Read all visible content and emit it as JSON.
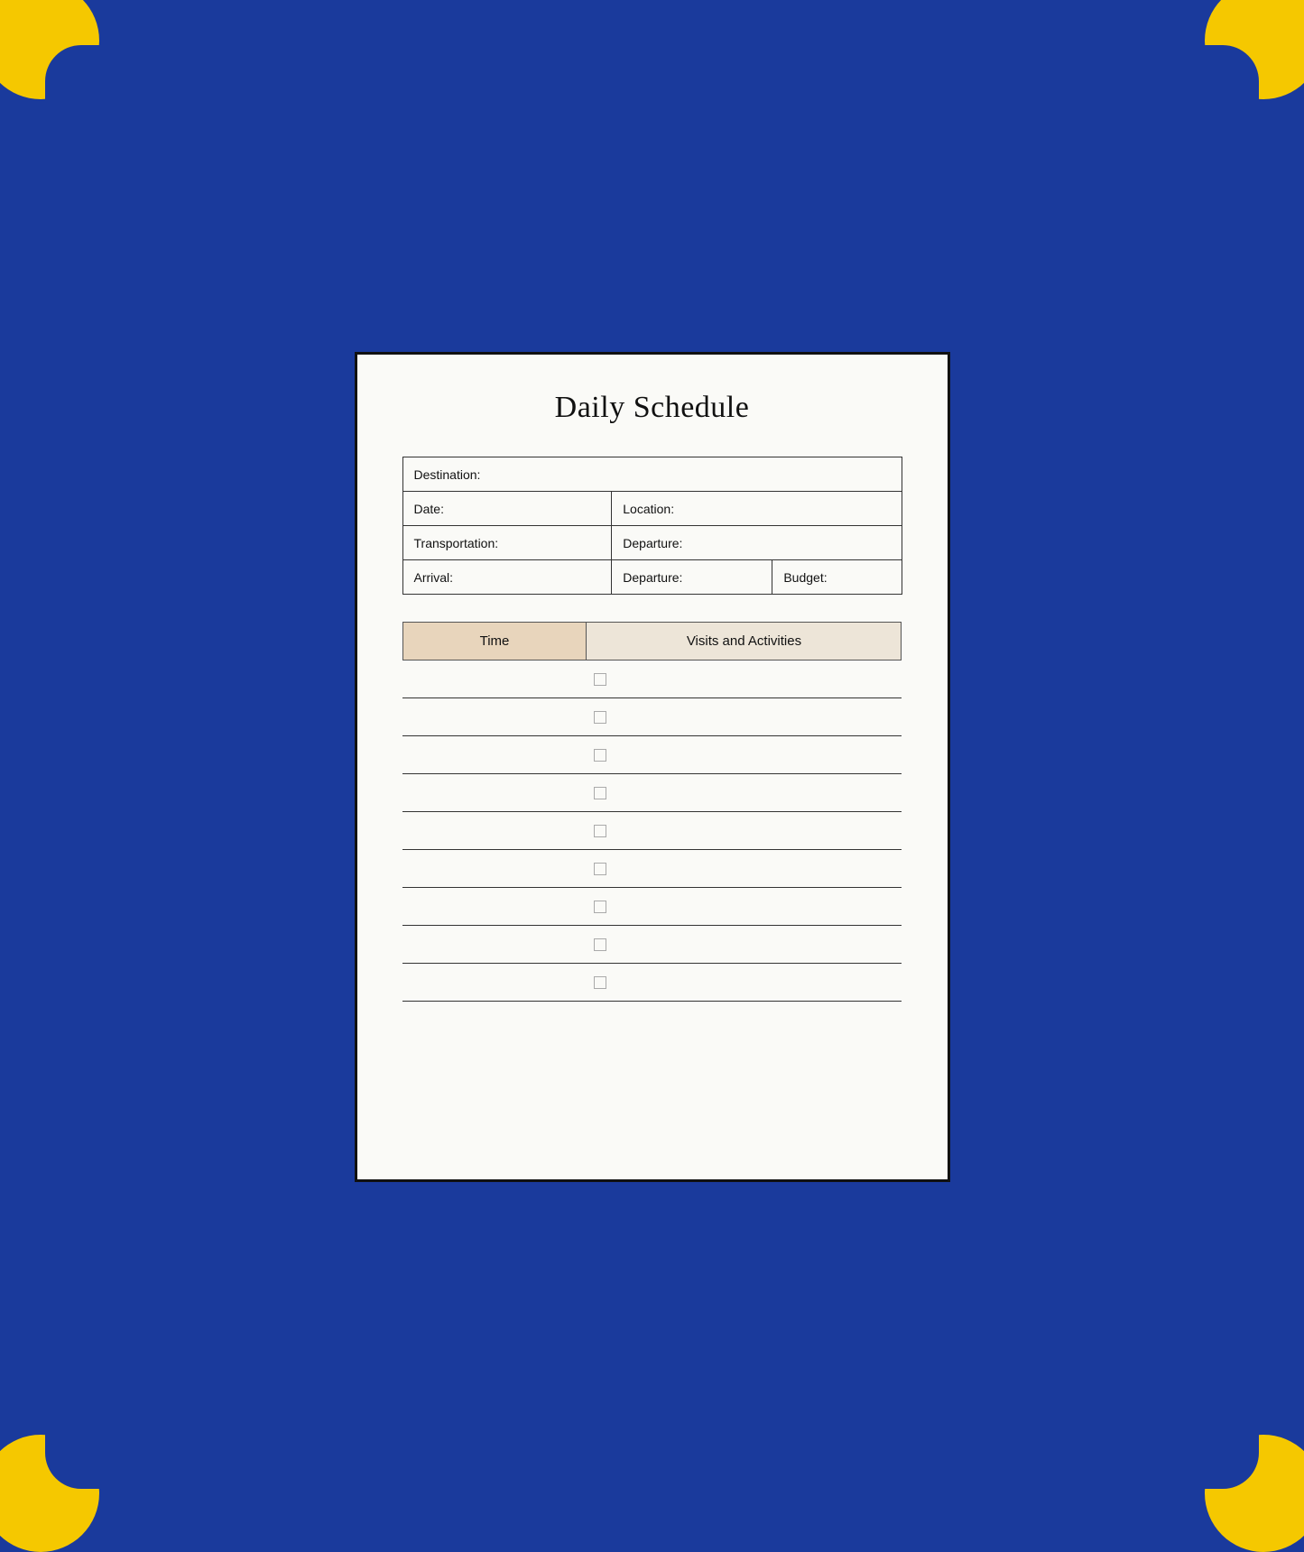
{
  "page": {
    "title": "Daily Schedule",
    "background_color": "#1a3a9c",
    "corner_color": "#f5c800"
  },
  "info_fields": {
    "destination_label": "Destination:",
    "date_label": "Date:",
    "location_label": "Location:",
    "transportation_label": "Transportation:",
    "departure_label": "Departure:",
    "arrival_label": "Arrival:",
    "departure2_label": "Departure:",
    "budget_label": "Budget:"
  },
  "schedule": {
    "time_header": "Time",
    "activities_header": "Visits and Activities",
    "rows": [
      {
        "id": 1
      },
      {
        "id": 2
      },
      {
        "id": 3
      },
      {
        "id": 4
      },
      {
        "id": 5
      },
      {
        "id": 6
      },
      {
        "id": 7
      },
      {
        "id": 8
      },
      {
        "id": 9
      }
    ]
  }
}
